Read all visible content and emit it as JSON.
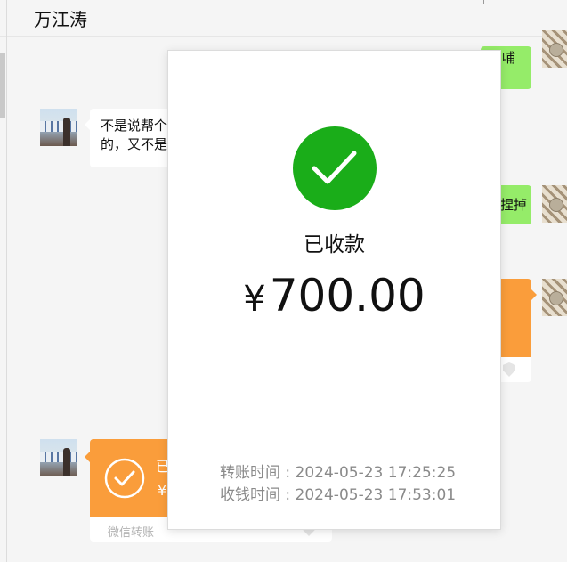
{
  "header": {
    "title": "万江涛"
  },
  "messages": {
    "received_text_line1": "不是说帮个",
    "received_text_line2": "的，又不是",
    "sent_fragment_top": "哺",
    "sent_fragment_mid": "捏掉"
  },
  "transfer_card": {
    "status_fragment": "已",
    "amount_fragment": "¥",
    "footer_label": "微信转账"
  },
  "modal": {
    "icon": "check-circle-icon",
    "status": "已收款",
    "currency": "¥",
    "amount": "700.00",
    "transfer_time_label": "转账时间 : ",
    "transfer_time": "2024-05-23 17:25:25",
    "receive_time_label": "收钱时间 : ",
    "receive_time": "2024-05-23 17:53:01"
  },
  "colors": {
    "accent_green": "#1aad19",
    "bubble_green": "#95ec69",
    "transfer_orange": "#fa9d3b"
  }
}
